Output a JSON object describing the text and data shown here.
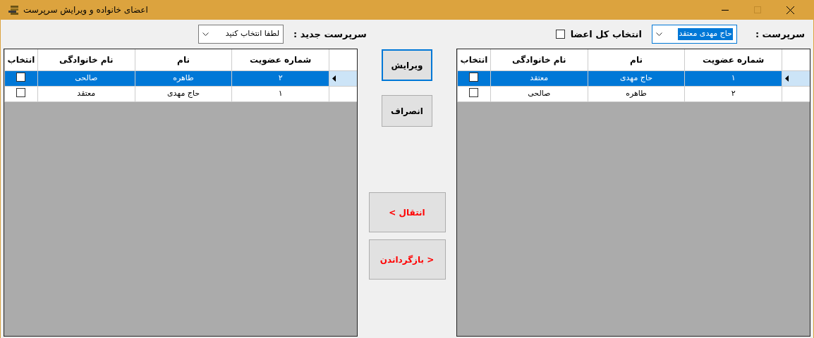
{
  "window": {
    "title": "اعضای خانواده و ویرایش سرپرست"
  },
  "supervisor": {
    "label": "سرپرست :",
    "value": "حاج مهدی معتقد"
  },
  "select_all": {
    "label": "انتخاب کل اعضا",
    "checked": false
  },
  "new_supervisor": {
    "label": "سرپرست جدید :",
    "placeholder": "لطفا انتخاب کنید"
  },
  "current_columns": [
    "شماره عضویت",
    "نام",
    "نام خانوادگی",
    "انتخاب"
  ],
  "new_columns": [
    "شماره عضویت",
    "نام",
    "نام خانوادگی",
    "انتخاب"
  ],
  "current_members": [
    {
      "number": "۱",
      "first_name": "حاج مهدی",
      "last_name": "معتقد",
      "checked": false,
      "selected": true
    },
    {
      "number": "۲",
      "first_name": "طاهره",
      "last_name": "صالحی",
      "checked": false,
      "selected": false
    }
  ],
  "new_members": [
    {
      "number": "۲",
      "first_name": "طاهره",
      "last_name": "صالحی",
      "checked": false,
      "selected": true
    },
    {
      "number": "۱",
      "first_name": "حاج مهدی",
      "last_name": "معتقد",
      "checked": false,
      "selected": false
    }
  ],
  "buttons": [
    {
      "label": "ویرایش",
      "kind": "focused"
    },
    {
      "label": "انصراف",
      "kind": "plain"
    }
  ],
  "transfer_buttons": [
    {
      "label": "انتقال >"
    },
    {
      "label": "< بازگرداندن"
    }
  ]
}
